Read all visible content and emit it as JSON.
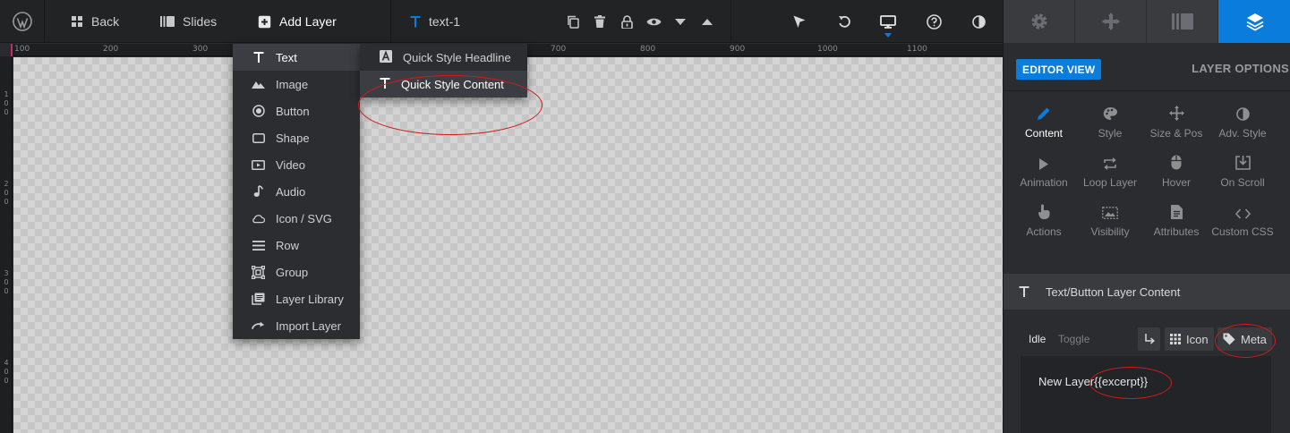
{
  "toolbar": {
    "back_label": "Back",
    "slides_label": "Slides",
    "add_layer_label": "Add Layer",
    "layer_name": "text-1"
  },
  "ruler": {
    "h_ticks": [
      "100",
      "200",
      "300",
      "700",
      "800",
      "900",
      "1000",
      "1100"
    ],
    "v_ticks": [
      "100",
      "200",
      "300",
      "400"
    ]
  },
  "add_layer_menu": {
    "items": [
      {
        "label": "Text",
        "icon": "text-icon"
      },
      {
        "label": "Image",
        "icon": "image-icon"
      },
      {
        "label": "Button",
        "icon": "button-icon"
      },
      {
        "label": "Shape",
        "icon": "shape-icon"
      },
      {
        "label": "Video",
        "icon": "video-icon"
      },
      {
        "label": "Audio",
        "icon": "audio-icon"
      },
      {
        "label": "Icon / SVG",
        "icon": "cloud-icon"
      },
      {
        "label": "Row",
        "icon": "row-icon"
      },
      {
        "label": "Group",
        "icon": "group-icon"
      },
      {
        "label": "Layer Library",
        "icon": "library-icon"
      },
      {
        "label": "Import Layer",
        "icon": "import-icon"
      }
    ],
    "active_index": 0
  },
  "text_submenu": {
    "items": [
      {
        "label": "Quick Style Headline",
        "icon": "headline-icon"
      },
      {
        "label": "Quick Style Content",
        "icon": "text-icon"
      }
    ],
    "active_index": 1
  },
  "panel": {
    "editor_view_label": "EDITOR VIEW",
    "layer_options_label": "LAYER OPTIONS",
    "options": [
      {
        "label": "Content",
        "icon": "pencil-icon"
      },
      {
        "label": "Style",
        "icon": "palette-icon"
      },
      {
        "label": "Size & Pos",
        "icon": "move-icon"
      },
      {
        "label": "Adv. Style",
        "icon": "contrast-icon"
      },
      {
        "label": "Animation",
        "icon": "play-icon"
      },
      {
        "label": "Loop Layer",
        "icon": "loop-icon"
      },
      {
        "label": "Hover",
        "icon": "mouse-icon"
      },
      {
        "label": "On Scroll",
        "icon": "scroll-icon"
      },
      {
        "label": "Actions",
        "icon": "hand-icon"
      },
      {
        "label": "Visibility",
        "icon": "visibility-icon"
      },
      {
        "label": "Attributes",
        "icon": "document-icon"
      },
      {
        "label": "Custom CSS",
        "icon": "code-icon"
      }
    ],
    "active_option": 0,
    "section_title": "Text/Button Layer Content",
    "tab_idle": "Idle",
    "tab_toggle": "Toggle",
    "icon_button_label": "Icon",
    "meta_button_label": "Meta",
    "layer_text": "New Layer{{excerpt}}"
  },
  "colors": {
    "accent": "#0a7cdb",
    "annotation": "#d11b1b",
    "toolbar_bg": "#222325",
    "panel_bg": "#2b2c30"
  }
}
